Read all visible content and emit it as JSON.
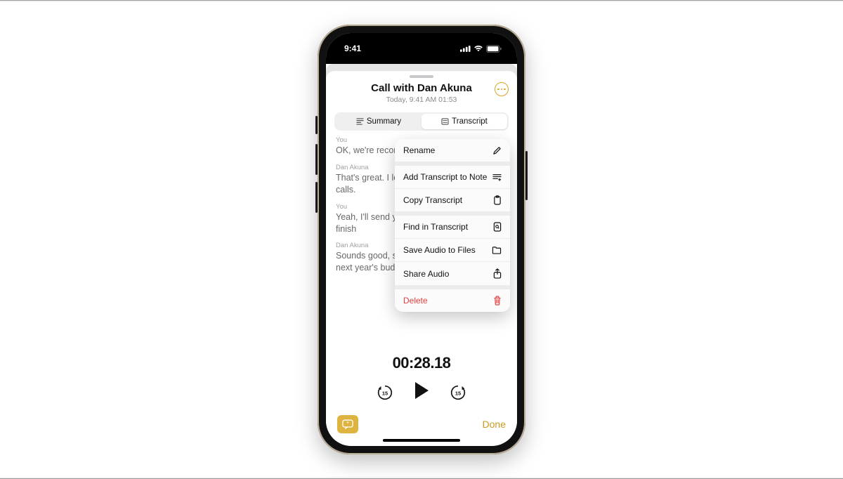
{
  "status": {
    "time": "9:41"
  },
  "header": {
    "title": "Call with Dan Akuna",
    "subtitle": "Today, 9:41 AM  01:53"
  },
  "tabs": {
    "summary": "Summary",
    "transcript": "Transcript"
  },
  "transcript": [
    {
      "speaker": "You",
      "text": "OK, we're recording now."
    },
    {
      "speaker": "Dan Akuna",
      "text": "That's great. I love that you can record calls."
    },
    {
      "speaker": "You",
      "text": "Yeah, I'll send you the transcript after we finish"
    },
    {
      "speaker": "Dan Akuna",
      "text": "Sounds good, so I'm almost finished with next year's budget proposal. I"
    }
  ],
  "playback": {
    "time": "00:28.18",
    "skip_seconds": "15"
  },
  "bottom": {
    "done": "Done"
  },
  "menu": {
    "rename": "Rename",
    "add_transcript": "Add Transcript to Note",
    "copy_transcript": "Copy Transcript",
    "find": "Find in Transcript",
    "save_audio": "Save Audio to Files",
    "share_audio": "Share Audio",
    "delete": "Delete"
  }
}
